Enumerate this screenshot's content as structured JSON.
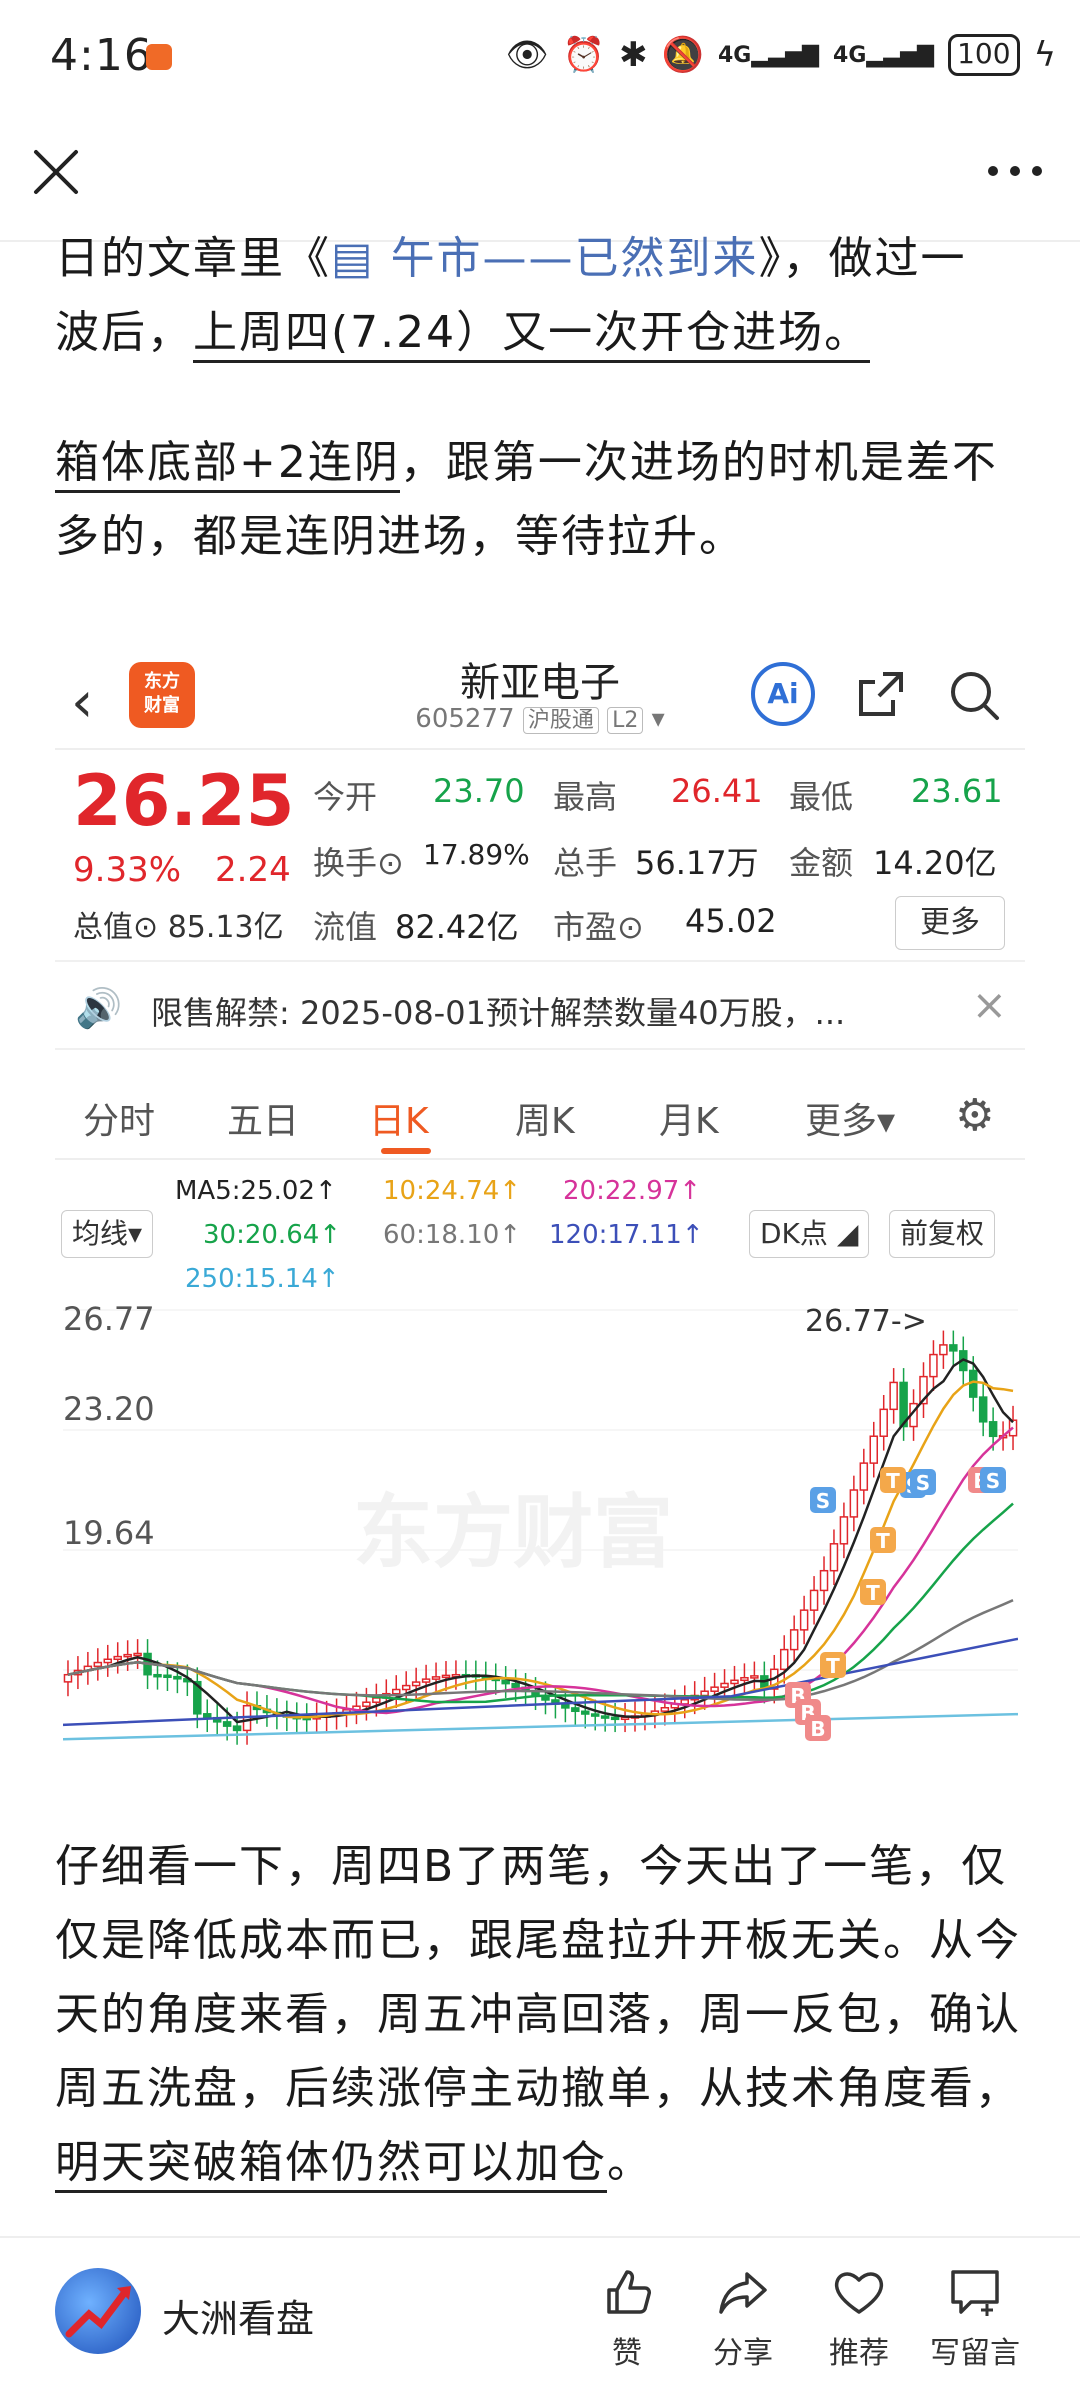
{
  "status_bar": {
    "time": "4:16",
    "network_1": "4G",
    "network_2": "4G",
    "battery": "100"
  },
  "article": {
    "p1_line1_pre": "日的文章里《",
    "p1_line1_link": "午市——已然到来",
    "p1_line1_post": "》，做过一",
    "p1_line2_pre": "波后，",
    "p1_line2_underlined": "上周四(7.24）又一次开仓进场。",
    "p2_underlined": "箱体底部+2连阴",
    "p2_rest": "，跟第一次进场的时机是差不多的，都是连阴进场，等待拉升。",
    "p3_text": "仔细看一下，周四B了两笔，今天出了一笔，仅仅是降低成本而已，跟尾盘拉升开板无关。从今天的角度来看，周五冲高回落，周一反包，确认周五洗盘，后续涨停主动撤单，从技术角度看，",
    "p3_underlined": "明天突破箱体仍然可以加仓",
    "p3_end": "。"
  },
  "stock_card": {
    "app_logo": "东方财富",
    "name": "新亚电子",
    "code": "605277",
    "exchange_tag": "沪股通",
    "level_tag": "L2",
    "ai_label": "Ai",
    "price": "26.25",
    "change_pct": "9.33%",
    "change_amt": "2.24",
    "market_cap_label": "总值",
    "market_cap": "85.13亿",
    "fields": {
      "open_label": "今开",
      "open": "23.70",
      "high_label": "最高",
      "high": "26.41",
      "low_label": "最低",
      "low": "23.61",
      "turnover_label": "换手",
      "turnover": "17.89%",
      "volume_label": "总手",
      "volume": "56.17万",
      "amount_label": "金额",
      "amount": "14.20亿",
      "float_label": "流值",
      "float_cap": "82.42亿",
      "pe_label": "市盈",
      "pe": "45.02"
    },
    "more_button": "更多",
    "notice_label": "限售解禁:",
    "notice_text": "2025-08-01预计解禁数量40万股，...",
    "tabs": [
      "分时",
      "五日",
      "日K",
      "周K",
      "月K",
      "更多"
    ],
    "active_tab": "日K",
    "indicator_button": "均线",
    "ma": {
      "ma5": "MA5:25.02↑",
      "ma10": "10:24.74↑",
      "ma20": "20:22.97↑",
      "ma30": "30:20.64↑",
      "ma60": "60:18.10↑",
      "ma120": "120:17.11↑",
      "ma250": "250:15.14↑"
    },
    "dk_button": "DK点",
    "fq_button": "前复权",
    "watermark": "东方财富",
    "high_marker": "26.77->"
  },
  "chart_data": {
    "type": "candlestick",
    "y_ticks": [
      "26.77",
      "23.20",
      "19.64"
    ],
    "ylim": [
      14.5,
      26.77
    ],
    "markers": [
      "B",
      "B",
      "B",
      "S",
      "S",
      "T",
      "T",
      "T",
      "T",
      "S",
      "B",
      "S"
    ],
    "colors": {
      "up": "#e0262b",
      "down": "#16a34a",
      "ma5": "#222222",
      "ma10": "#e8a317",
      "ma20": "#d6339a",
      "ma30": "#16a34a",
      "ma60": "#777777",
      "ma120": "#3c4fb8",
      "ma250": "#6cc1e0"
    }
  },
  "bottom_bar": {
    "author": "大洲看盘",
    "actions": [
      "赞",
      "分享",
      "推荐",
      "写留言"
    ]
  }
}
